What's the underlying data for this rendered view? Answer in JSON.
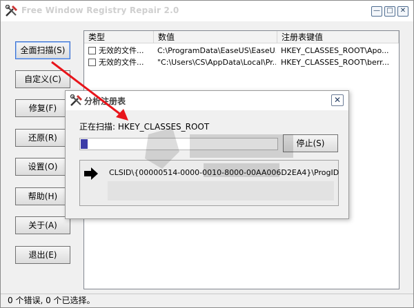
{
  "window": {
    "title": "Free Window Registry Repair 2.0",
    "controls": {
      "minimize": "—",
      "maximize": "□",
      "close": "✕"
    }
  },
  "sidebar": {
    "buttons": [
      {
        "label": "全面扫描(S)"
      },
      {
        "label": "自定义(C)"
      },
      {
        "label": "修复(F)"
      },
      {
        "label": "还原(R)"
      },
      {
        "label": "设置(O)"
      },
      {
        "label": "帮助(H)"
      },
      {
        "label": "关于(A)"
      },
      {
        "label": "退出(E)"
      }
    ]
  },
  "list": {
    "columns": [
      "类型",
      "数值",
      "注册表键值"
    ],
    "rows": [
      {
        "type": "无效的文件...",
        "value": "C:\\ProgramData\\EaseUS\\EaseU...",
        "key": "HKEY_CLASSES_ROOT\\Apo..."
      },
      {
        "type": "无效的文件...",
        "value": "\"C:\\Users\\CS\\AppData\\Local\\Pr...",
        "key": "HKEY_CLASSES_ROOT\\berr..."
      }
    ]
  },
  "status": {
    "text": "0 个错误,   0 个已选择。"
  },
  "dialog": {
    "title": "分析注册表",
    "close": "✕",
    "scan_label": "正在扫描: HKEY_CLASSES_ROOT",
    "progress_fraction": 0.035,
    "stop_label": "停止(S)",
    "current_path": "CLSID\\{00000514-0000-0010-8000-00AA006D2EA4}\\ProgID"
  },
  "colors": {
    "progress_fill": "#3d3da8",
    "annotation_arrow": "#e8151b"
  },
  "icons": {
    "app": "tools-icon",
    "path": "right-arrow-icon"
  }
}
